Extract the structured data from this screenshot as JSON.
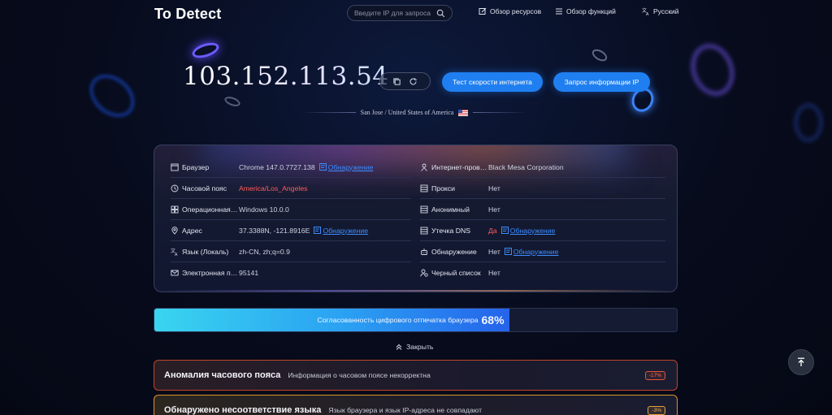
{
  "header": {
    "logo": "To Detect",
    "search_placeholder": "Введите IP для запроса",
    "nav": [
      {
        "label": "Обзор ресурсов",
        "icon": "edit-square-icon"
      },
      {
        "label": "Обзор функций",
        "icon": "menu-icon"
      },
      {
        "label": "Русский",
        "icon": "translate-icon"
      }
    ]
  },
  "hero": {
    "ip": "103.152.113.54",
    "speed_test_label": "Тест скорости интернета",
    "ip_query_label": "Запрос информации IP",
    "location": "San Jose / United States of America"
  },
  "info": {
    "left": [
      {
        "icon": "browser-icon",
        "label": "Браузер",
        "value": "Chrome 147.0.7727.138",
        "detect": "Обнаружение"
      },
      {
        "icon": "clock-icon",
        "label": "Часовой пояс",
        "value": "America/Los_Angeles",
        "warn": true
      },
      {
        "icon": "os-icon",
        "label": "Операционная система",
        "value": "Windows 10.0.0"
      },
      {
        "icon": "location-pin-icon",
        "label": "Адрес",
        "value": "37.3388N, -121.8916E",
        "detect": "Обнаружение"
      },
      {
        "icon": "translate-icon",
        "label": "Язык (Локаль)",
        "value": "zh-CN, zh;q=0.9"
      },
      {
        "icon": "mail-icon",
        "label": "Электронная почта",
        "value": "95141"
      }
    ],
    "right": [
      {
        "icon": "user-network-icon",
        "label": "Интернет-провайдер",
        "value": "Black Mesa Corporation"
      },
      {
        "icon": "server-icon",
        "label": "Прокси",
        "value": "Нет"
      },
      {
        "icon": "server-icon",
        "label": "Анонимный",
        "value": "Нет"
      },
      {
        "icon": "server-icon",
        "label": "Утечка DNS",
        "value": "Да",
        "warn": true,
        "detect": "Обнаружение"
      },
      {
        "icon": "robot-icon",
        "label": "Обнаружение",
        "value": "Нет",
        "detect": "Обнаружение"
      },
      {
        "icon": "user-blacklist-icon",
        "label": "Черный список",
        "value": "Нет"
      }
    ]
  },
  "fingerprint": {
    "label": "Согласованность цифрового отпечатка браузера",
    "percent_text": "68%",
    "percent": 68
  },
  "close_label": "Закрыть",
  "alerts": [
    {
      "title": "Аномалия часового пояса",
      "desc": "Информация о часовом поясе некорректна",
      "badge": "-17%",
      "level": "error"
    },
    {
      "title": "Обнаружено несоответствие языка",
      "desc": "Язык браузера и язык IP-адреса не совпадают",
      "badge": "-3%",
      "level": "warning"
    }
  ],
  "colors": {
    "accent": "#1f7ff0",
    "danger": "#ff5b5b",
    "warning": "#e5a23a",
    "link": "#3d8cff"
  }
}
